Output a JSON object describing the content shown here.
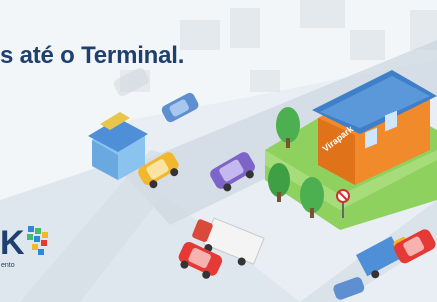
{
  "banner": {
    "headline": "s até o Terminal.",
    "sign_text": "Virapark",
    "logo_letter": "K",
    "logo_tagline": "ento"
  },
  "colors": {
    "headline": "#1f3f6e",
    "ground": "#e6edf3",
    "lawn": "#8fd15f",
    "building_roof": "#3f7fc8",
    "building_wall": "#f08a2a"
  },
  "icons": [
    "brand-logo-mark",
    "no-parking-sign-icon"
  ]
}
